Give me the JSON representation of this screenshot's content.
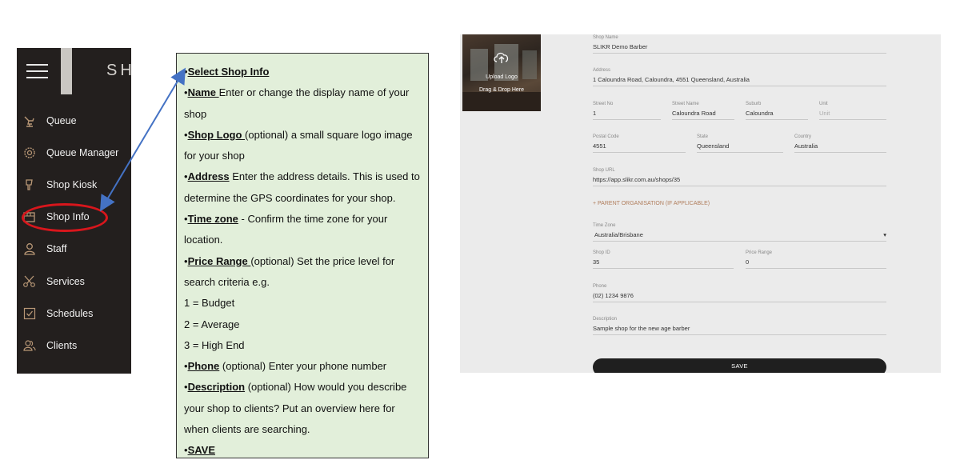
{
  "sidebar": {
    "brand_text": "SH",
    "items": [
      {
        "label": "Queue",
        "icon": "barber-chair-icon"
      },
      {
        "label": "Queue Manager",
        "icon": "gear-icon"
      },
      {
        "label": "Shop Kiosk",
        "icon": "kiosk-icon"
      },
      {
        "label": "Shop Info",
        "icon": "shop-icon"
      },
      {
        "label": "Staff",
        "icon": "person-icon"
      },
      {
        "label": "Services",
        "icon": "scissors-icon"
      },
      {
        "label": "Schedules",
        "icon": "checkbox-icon"
      },
      {
        "label": "Clients",
        "icon": "clients-icon"
      }
    ],
    "highlight_color": "#d8161c"
  },
  "instructions": {
    "bullet": "•",
    "select_title": "Select Shop Info",
    "name_kw": "Name ",
    "name_text": "Enter or change the display name of your shop",
    "logo_kw": "Shop Logo ",
    "logo_text": "(optional) a small square logo image for your shop",
    "address_kw": "Address",
    "address_text": " Enter the address details. This is used to determine the GPS coordinates for your shop.",
    "timezone_kw": "Time zone",
    "timezone_text": " - Confirm the time zone for your location.",
    "price_kw": "Price Range ",
    "price_text": "(optional) Set the price level for search criteria e.g.",
    "price_levels": [
      "1 = Budget",
      "2 = Average",
      "3 = High End"
    ],
    "phone_kw": "Phone",
    "phone_text": " (optional) Enter your phone number",
    "desc_kw": "Description",
    "desc_text": " (optional) How would you describe your shop to clients? Put an overview here for when clients are searching.",
    "save_kw": "SAVE"
  },
  "form": {
    "logo": {
      "upload_label": "Upload Logo",
      "drag_label": "Drag & Drop Here"
    },
    "shop_name": {
      "label": "Shop Name",
      "value": "SLIKR Demo Barber"
    },
    "address": {
      "label": "Address",
      "value": "1 Caloundra Road, Caloundra, 4551 Queensland, Australia"
    },
    "street_no": {
      "label": "Street No",
      "value": "1"
    },
    "street_name": {
      "label": "Street Name",
      "value": "Caloundra Road"
    },
    "suburb": {
      "label": "Suburb",
      "value": "Caloundra"
    },
    "unit": {
      "label": "Unit",
      "placeholder": "Unit"
    },
    "postal_code": {
      "label": "Postal Code",
      "value": "4551"
    },
    "state": {
      "label": "State",
      "value": "Queensland"
    },
    "country": {
      "label": "Country",
      "value": "Australia"
    },
    "shop_url": {
      "label": "Shop URL",
      "value": "https://app.slikr.com.au/shops/35"
    },
    "parent_org": "+ PARENT ORGANISATION (IF APPLICABLE)",
    "time_zone": {
      "label": "Time Zone",
      "value": "Australia/Brisbane",
      "caret": "▾"
    },
    "shop_id": {
      "label": "Shop ID",
      "value": "35"
    },
    "price_range": {
      "label": "Price Range",
      "value": "0"
    },
    "phone": {
      "label": "Phone",
      "value": "(02) 1234 9876"
    },
    "description": {
      "label": "Description",
      "value": "Sample shop for the new age barber"
    },
    "save_label": "SAVE"
  },
  "colors": {
    "instructions_bg": "#e2efda",
    "arrow": "#4472c4",
    "sidebar_bg": "#231f1e",
    "accent": "#b07d5c"
  }
}
